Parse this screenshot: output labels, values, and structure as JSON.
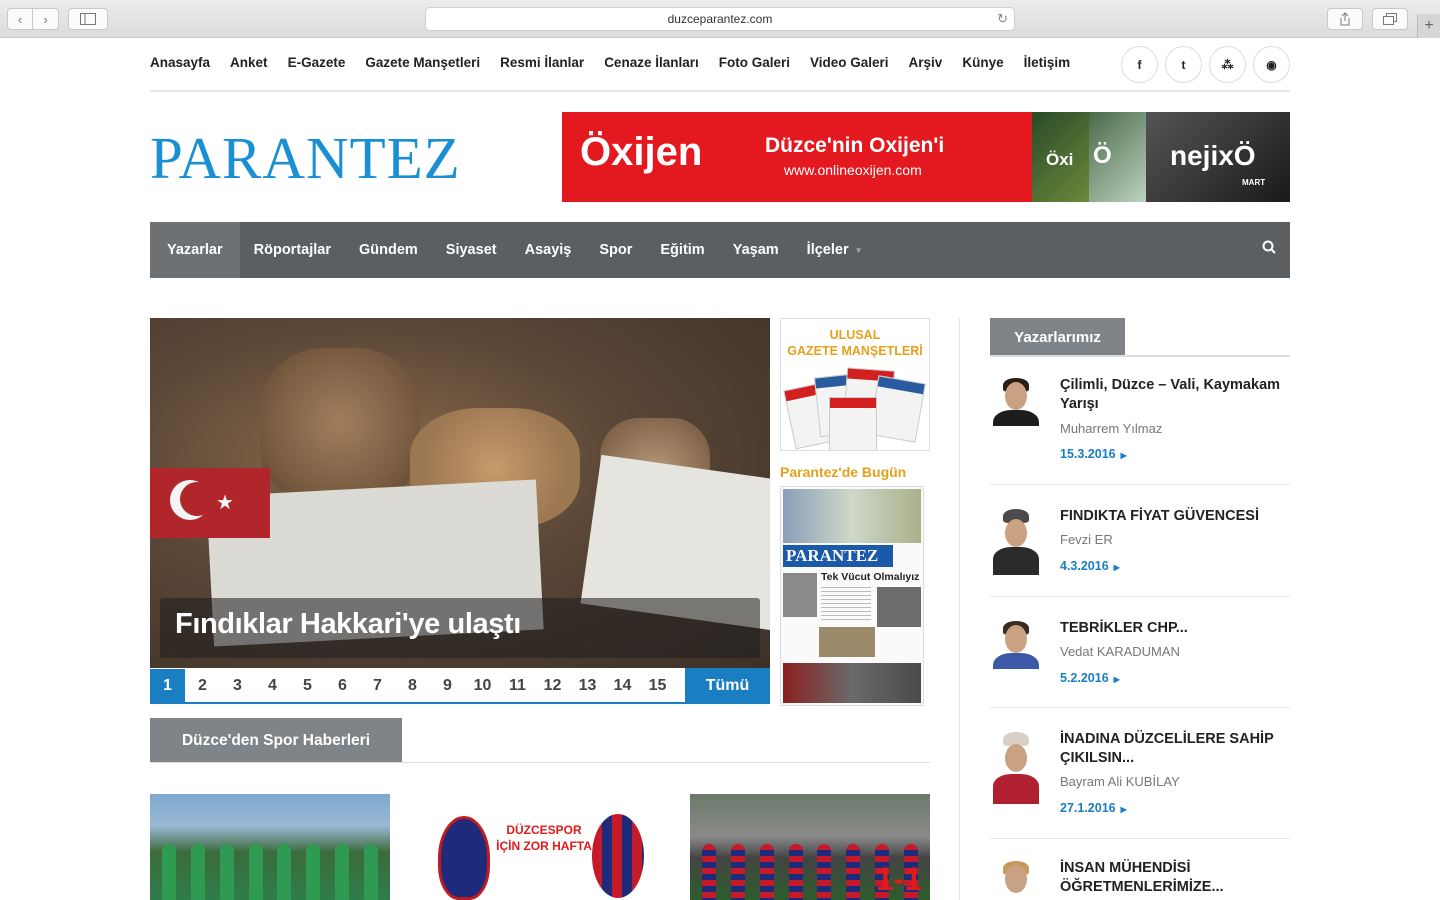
{
  "browser": {
    "url": "duzceparantez.com",
    "back": "‹",
    "forward": "›",
    "new_tab": "+"
  },
  "top_links": [
    "Anasayfa",
    "Anket",
    "E-Gazete",
    "Gazete Manşetleri",
    "Resmi İlanlar",
    "Cenaze İlanları",
    "Foto Galeri",
    "Video Galeri",
    "Arşiv",
    "Künye",
    "İletişim"
  ],
  "socials": [
    {
      "icon": "facebook-icon",
      "glyph": "f"
    },
    {
      "icon": "twitter-icon",
      "glyph": "t"
    },
    {
      "icon": "sitemap-icon",
      "glyph": "⁂"
    },
    {
      "icon": "rss-icon",
      "glyph": "◉"
    }
  ],
  "logo": "PARANTEZ",
  "banner": {
    "brand": "Öxijen",
    "tagline": "Düzce'nin Oxijen'i",
    "url": "www.onlineoxijen.com",
    "mag1": "Öxi",
    "mag2": "Ö",
    "mag3": "nejixÖ",
    "mag3_sub": "MART"
  },
  "main_nav": [
    "Yazarlar",
    "Röportajlar",
    "Gündem",
    "Siyaset",
    "Asayiş",
    "Spor",
    "Eğitim",
    "Yaşam",
    "İlçeler"
  ],
  "main_nav_dropdown_caret": "▼",
  "search_glyph": "🔍",
  "slider": {
    "caption": "Fındıklar Hakkari'ye ulaştı",
    "pages": [
      "1",
      "2",
      "3",
      "4",
      "5",
      "6",
      "7",
      "8",
      "9",
      "10",
      "11",
      "12",
      "13",
      "14",
      "15"
    ],
    "active_page": "1",
    "all_label": "Tümü"
  },
  "mid": {
    "headlines_title_1": "ULUSAL",
    "headlines_title_2": "GAZETE MANŞETLERİ",
    "today_title": "Parantez'de Bugün",
    "today_logo": "PARANTEZ",
    "today_headline": "Tek Vücut Olmalıyız"
  },
  "sport": {
    "title": "Düzce'den Spor Haberleri",
    "badge_text": "DÜZCESPOR İÇİN ZOR HAFTA",
    "score": "1-1"
  },
  "writers": {
    "title": "Yazarlarımız",
    "items": [
      {
        "title": "Çilimli, Düzce – Vali, Kaymakam Yarışı",
        "name": "Muharrem Yılmaz",
        "date": "15.3.2016"
      },
      {
        "title": "FINDIKTA FİYAT GÜVENCESİ",
        "name": "Fevzi ER",
        "date": "4.3.2016"
      },
      {
        "title": "TEBRİKLER CHP...",
        "name": "Vedat KARADUMAN",
        "date": "5.2.2016"
      },
      {
        "title": "İNADINA DÜZCELİLERE SAHİP ÇIKILSIN...",
        "name": "Bayram Ali KUBİLAY",
        "date": "27.1.2016"
      },
      {
        "title": "İNSAN MÜHENDİSİ ÖĞRETMENLERİMİZE...",
        "name": "",
        "date": ""
      }
    ],
    "arrow": "▶"
  }
}
